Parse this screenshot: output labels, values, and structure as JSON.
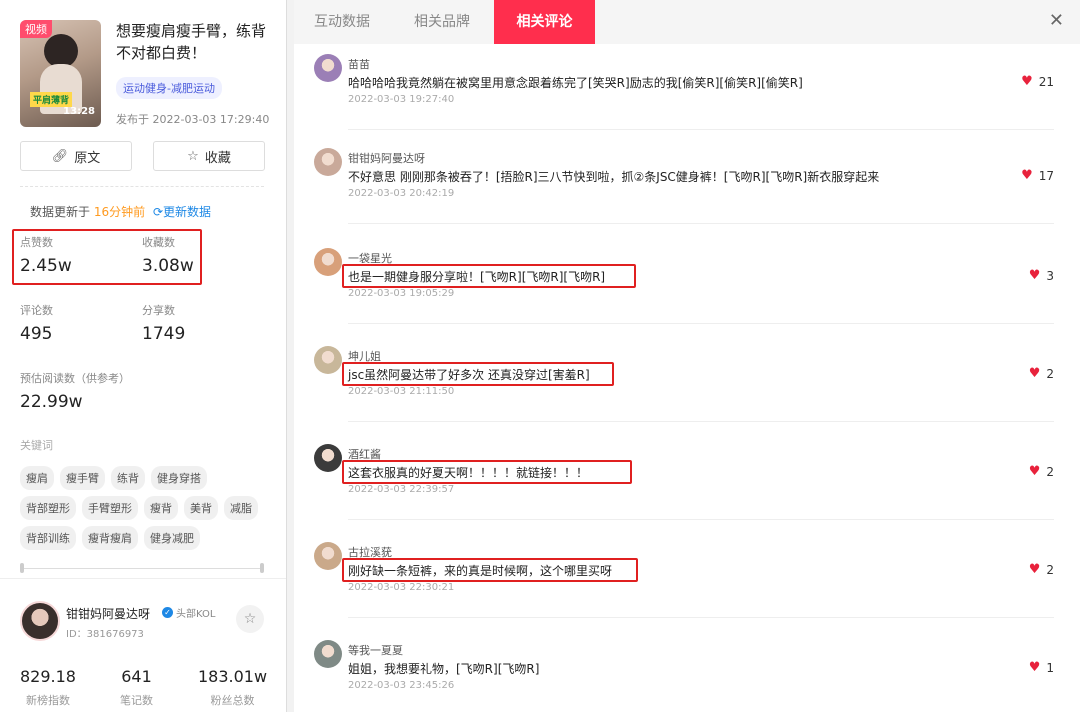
{
  "video": {
    "tag": "视频",
    "caption": "平肩薄背",
    "duration": "13:28",
    "title": "想要瘦肩瘦手臂，练背不对都白费！",
    "topic": "运动健身-减肥运动",
    "published": "发布于 2022-03-03 17:29:40"
  },
  "actions": {
    "original": "原文",
    "favorite": "收藏"
  },
  "update": {
    "prefix": "数据更新于",
    "ago": "16分钟前",
    "refresh": "更新数据"
  },
  "stats": {
    "likes_label": "点赞数",
    "likes": "2.45w",
    "collects_label": "收藏数",
    "collects": "3.08w",
    "comments_label": "评论数",
    "comments": "495",
    "shares_label": "分享数",
    "shares": "1749",
    "reads_label": "预估阅读数（供参考）",
    "reads": "22.99w"
  },
  "keywords": {
    "title": "关键词",
    "items": [
      "瘦肩",
      "瘦手臂",
      "练背",
      "健身穿搭",
      "背部塑形",
      "手臂塑形",
      "瘦背",
      "美背",
      "减脂",
      "背部训练",
      "瘦背瘦肩",
      "健身减肥"
    ]
  },
  "author": {
    "name": "钳钳妈阿曼达呀",
    "badge": "头部KOL",
    "id": "ID：381676973",
    "new_index": "829.18",
    "new_index_label": "新榜指数",
    "notes": "641",
    "notes_label": "笔记数",
    "fans": "183.01w",
    "fans_label": "粉丝总数"
  },
  "tabs": [
    "互动数据",
    "相关品牌",
    "相关评论"
  ],
  "active_tab": 2,
  "comments": [
    {
      "name": "苗苗",
      "text": "哈哈哈哈我竟然躺在被窝里用意念跟着练完了[笑哭R]励志的我[偷笑R][偷笑R][偷笑R]",
      "time": "2022-03-03 19:27:40",
      "likes": "21"
    },
    {
      "name": "钳钳妈阿曼达呀",
      "text": "不好意思 刚刚那条被吞了！[捂脸R]三八节快到啦，抓②条JSC健身裤！[飞吻R][飞吻R]新衣服穿起来",
      "time": "2022-03-03 20:42:19",
      "likes": "17"
    },
    {
      "name": "一袋星光",
      "text": "也是一期健身服分享啦！[飞吻R][飞吻R][飞吻R]",
      "time": "2022-03-03 19:05:29",
      "likes": "3"
    },
    {
      "name": "坤儿姐",
      "text": "jsc虽然阿曼达带了好多次 还真没穿过[害羞R]",
      "time": "2022-03-03 21:11:50",
      "likes": "2"
    },
    {
      "name": "酒红酱",
      "text": "这套衣服真的好夏天啊！！！！就链接！！！",
      "time": "2022-03-03 22:39:57",
      "likes": "2"
    },
    {
      "name": "古拉溪莸",
      "text": "刚好缺一条短裤，来的真是时候啊，这个哪里买呀",
      "time": "2022-03-03 22:30:21",
      "likes": "2"
    },
    {
      "name": "等我一夏夏",
      "text": "姐姐，我想要礼物，[飞吻R][飞吻R]",
      "time": "2022-03-03 23:45:26",
      "likes": "1"
    }
  ],
  "colors": {
    "accent": "#ff2e4d",
    "highlight_box": "#e02020",
    "heart": "#e8223c",
    "link": "#1e88e5"
  }
}
